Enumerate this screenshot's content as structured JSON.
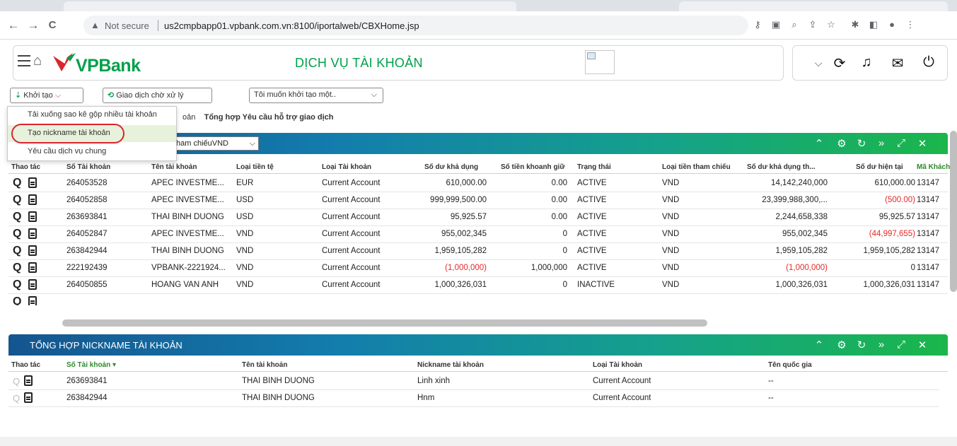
{
  "browser": {
    "nav": {
      "back": "←",
      "forward": "→",
      "reload": "C"
    },
    "security": "Not secure",
    "url": "us2cmpbapp01.vpbank.com.vn:8100/iportalweb/CBXHome.jsp"
  },
  "header": {
    "brand": "VPBank",
    "title": "DỊCH VỤ TÀI KHOẢN"
  },
  "toolbar": {
    "khoitao": "Khởi tạo",
    "giaodich": "Giao dịch chờ xử lý",
    "toimuon": "Tôi muốn khởi tạo một.."
  },
  "dropdown": {
    "items": [
      "Tải xuống sao kê gộp nhiều tài khoản",
      "Tạo nickname tài khoản",
      "Yêu cầu dịch vụ chung"
    ]
  },
  "breadcrumb": {
    "frag": "oản",
    "label": "Tổng hợp Yêu cầu hỗ trợ giao dịch"
  },
  "accounts_panel": {
    "ref_select": "ham chiếuVND",
    "columns": [
      "Thao tác",
      "Số Tài khoản",
      "Tên tài khoản",
      "Loại tiền tệ",
      "Loại Tài khoản",
      "Số dư khả dụng",
      "Số tiền khoanh giữ",
      "Trạng thái",
      "Loại tiền tham chiếu",
      "Số dư khả dụng th...",
      "Số dư hiện tại",
      "Mã Khách"
    ],
    "rows": [
      {
        "acc": "264053528",
        "name": "APEC INVESTME...",
        "cur": "EUR",
        "type": "Current Account",
        "avail": "610,000.00",
        "hold": "0.00",
        "status": "ACTIVE",
        "ref": "VND",
        "avail_ref": "14,142,240,000",
        "current": "610,000.00",
        "cust": "13147"
      },
      {
        "acc": "264052858",
        "name": "APEC INVESTME...",
        "cur": "USD",
        "type": "Current Account",
        "avail": "999,999,500.00",
        "hold": "0.00",
        "status": "ACTIVE",
        "ref": "VND",
        "avail_ref": "23,399,988,300,...",
        "current": "(500.00)",
        "cust": "13147"
      },
      {
        "acc": "263693841",
        "name": "THAI BINH DUONG",
        "cur": "USD",
        "type": "Current Account",
        "avail": "95,925.57",
        "hold": "0.00",
        "status": "ACTIVE",
        "ref": "VND",
        "avail_ref": "2,244,658,338",
        "current": "95,925.57",
        "cust": "13147"
      },
      {
        "acc": "264052847",
        "name": "APEC INVESTME...",
        "cur": "VND",
        "type": "Current Account",
        "avail": "955,002,345",
        "hold": "0",
        "status": "ACTIVE",
        "ref": "VND",
        "avail_ref": "955,002,345",
        "current": "(44,997,655)",
        "cust": "13147"
      },
      {
        "acc": "263842944",
        "name": "THAI BINH DUONG",
        "cur": "VND",
        "type": "Current Account",
        "avail": "1,959,105,282",
        "hold": "0",
        "status": "ACTIVE",
        "ref": "VND",
        "avail_ref": "1,959,105,282",
        "current": "1,959,105,282",
        "cust": "13147"
      },
      {
        "acc": "222192439",
        "name": "VPBANK-2221924...",
        "cur": "VND",
        "type": "Current Account",
        "avail": "(1,000,000)",
        "hold": "1,000,000",
        "status": "ACTIVE",
        "ref": "VND",
        "avail_ref": "(1,000,000)",
        "current": "0",
        "cust": "13147"
      },
      {
        "acc": "264050855",
        "name": "HOANG VAN ANH",
        "cur": "VND",
        "type": "Current Account",
        "avail": "1,000,326,031",
        "hold": "0",
        "status": "INACTIVE",
        "ref": "VND",
        "avail_ref": "1,000,326,031",
        "current": "1,000,326,031",
        "cust": "13147"
      }
    ]
  },
  "nickname_panel": {
    "title": "TỔNG HỢP NICKNAME TÀI KHOẢN",
    "columns": [
      "Thao tác",
      "Số Tài khoản ▾",
      "Tên tài khoản",
      "Nickname tài khoản",
      "Loại Tài khoản",
      "Tên quốc gia"
    ],
    "rows": [
      {
        "acc": "263693841",
        "name": "THAI BINH DUONG",
        "nick": "Linh xinh",
        "type": "Current Account",
        "country": "--"
      },
      {
        "acc": "263842944",
        "name": "THAI BINH DUONG",
        "nick": "Hnm",
        "type": "Current Account",
        "country": "--"
      }
    ]
  },
  "colors": {
    "brand_green": "#00a04a",
    "brand_red": "#d9262d",
    "negative": "#e42a2a"
  }
}
